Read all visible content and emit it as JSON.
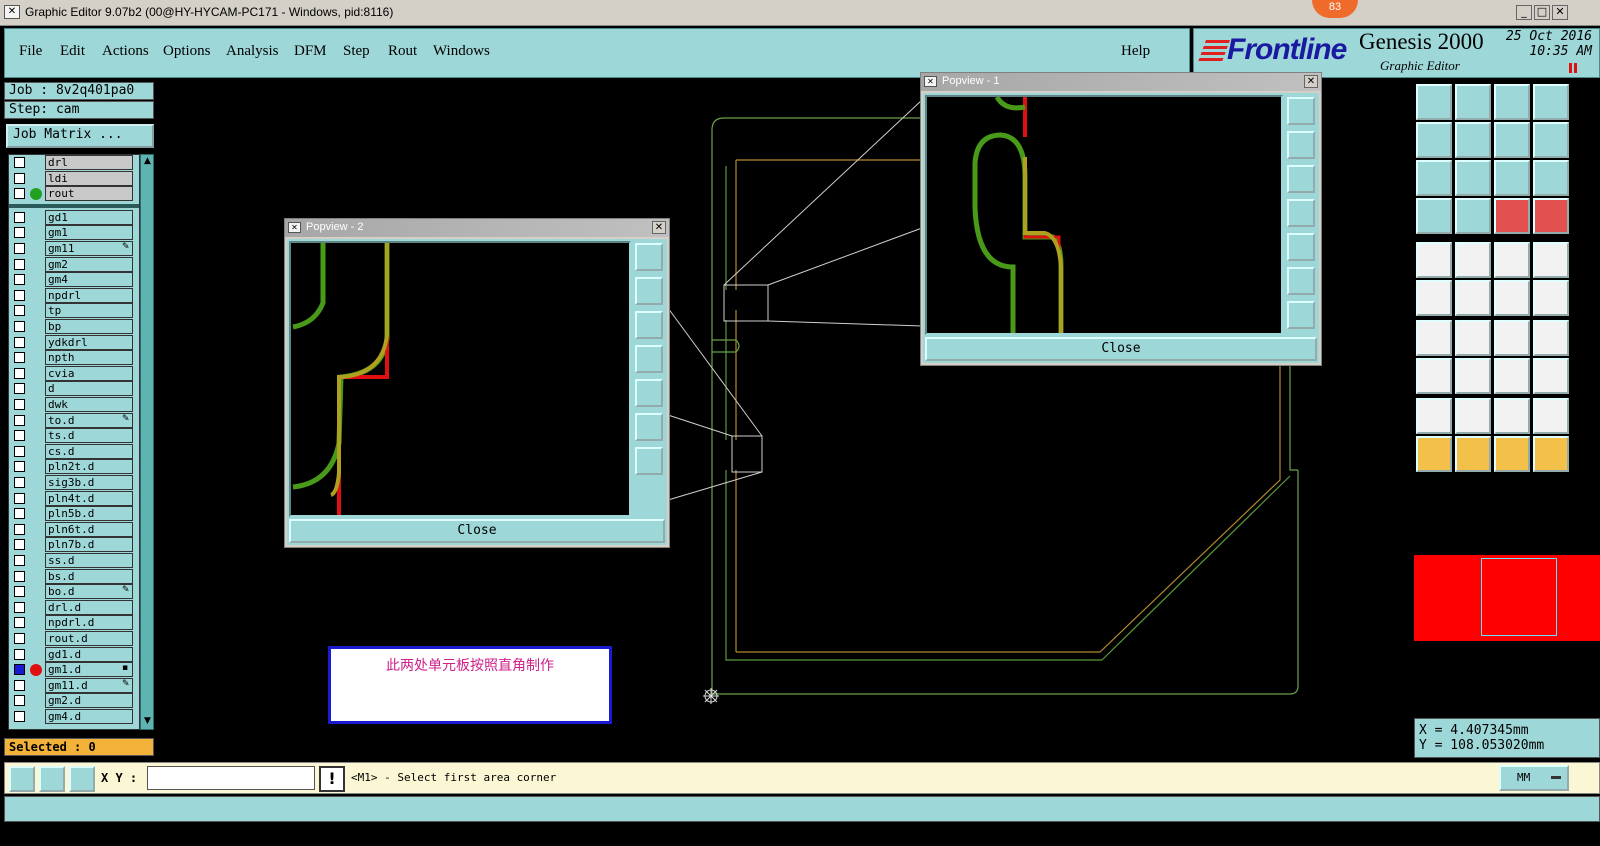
{
  "window": {
    "title": "Graphic Editor 9.07b2 (00@HY-HYCAM-PC171 - Windows, pid:8116)",
    "notification_count": "83"
  },
  "menu": {
    "file": "File",
    "edit": "Edit",
    "actions": "Actions",
    "options": "Options",
    "analysis": "Analysis",
    "dfm": "DFM",
    "step": "Step",
    "rout": "Rout",
    "windows": "Windows",
    "help": "Help"
  },
  "brand": {
    "logo": "Frontline",
    "product": "Genesis 2000",
    "subtitle": "Graphic Editor",
    "date": "25 Oct 2016",
    "time": "10:35 AM"
  },
  "job": {
    "job_label": "Job : 8v2q401pa0",
    "step_label": "Step: cam",
    "matrix_button": "Job Matrix ..."
  },
  "layers_top": [
    {
      "name": "drl",
      "gray": true,
      "dot": ""
    },
    {
      "name": "ldi",
      "gray": true,
      "dot": ""
    },
    {
      "name": "rout",
      "gray": true,
      "dot": "#22a022"
    }
  ],
  "layers": [
    {
      "name": "gd1",
      "mark": ""
    },
    {
      "name": "gm1",
      "mark": ""
    },
    {
      "name": "gm11",
      "mark": "✎"
    },
    {
      "name": "gm2",
      "mark": ""
    },
    {
      "name": "gm4",
      "mark": ""
    },
    {
      "name": "npdrl",
      "mark": ""
    },
    {
      "name": "tp",
      "mark": ""
    },
    {
      "name": "bp",
      "mark": ""
    },
    {
      "name": "ydkdrl",
      "mark": ""
    },
    {
      "name": "npth",
      "mark": ""
    },
    {
      "name": "cvia",
      "mark": ""
    },
    {
      "name": "d",
      "mark": ""
    },
    {
      "name": "dwk",
      "mark": ""
    },
    {
      "name": "to.d",
      "mark": "✎"
    },
    {
      "name": "ts.d",
      "mark": ""
    },
    {
      "name": "cs.d",
      "mark": ""
    },
    {
      "name": "pln2t.d",
      "mark": ""
    },
    {
      "name": "sig3b.d",
      "mark": ""
    },
    {
      "name": "pln4t.d",
      "mark": ""
    },
    {
      "name": "pln5b.d",
      "mark": ""
    },
    {
      "name": "pln6t.d",
      "mark": ""
    },
    {
      "name": "pln7b.d",
      "mark": ""
    },
    {
      "name": "ss.d",
      "mark": ""
    },
    {
      "name": "bs.d",
      "mark": ""
    },
    {
      "name": "bo.d",
      "mark": "✎"
    },
    {
      "name": "drl.d",
      "mark": ""
    },
    {
      "name": "npdrl.d",
      "mark": ""
    },
    {
      "name": "rout.d",
      "mark": ""
    },
    {
      "name": "gd1.d",
      "mark": ""
    },
    {
      "name": "gm1.d",
      "mark": "▪",
      "active": true
    },
    {
      "name": "gm11.d",
      "mark": "✎"
    },
    {
      "name": "gm2.d",
      "mark": ""
    },
    {
      "name": "gm4.d",
      "mark": ""
    }
  ],
  "selected_label": "Selected : 0",
  "popview1": {
    "title": "Popview - 1",
    "close_label": "Close"
  },
  "popview2": {
    "title": "Popview - 2",
    "close_label": "Close"
  },
  "note_text": "此两处单元板按照直角制作",
  "coords": {
    "x": "X = 4.407345mm",
    "y": "Y = 108.053020mm"
  },
  "command": {
    "xy_label": "X Y :",
    "xy_value": "",
    "prompt": "<M1> - Select first area corner",
    "units": "MM"
  },
  "colors": {
    "panel": "#9ed7d8",
    "outline_green": "#4a9a1a",
    "outline_olive": "#b0a020",
    "outline_red": "#e01010"
  }
}
